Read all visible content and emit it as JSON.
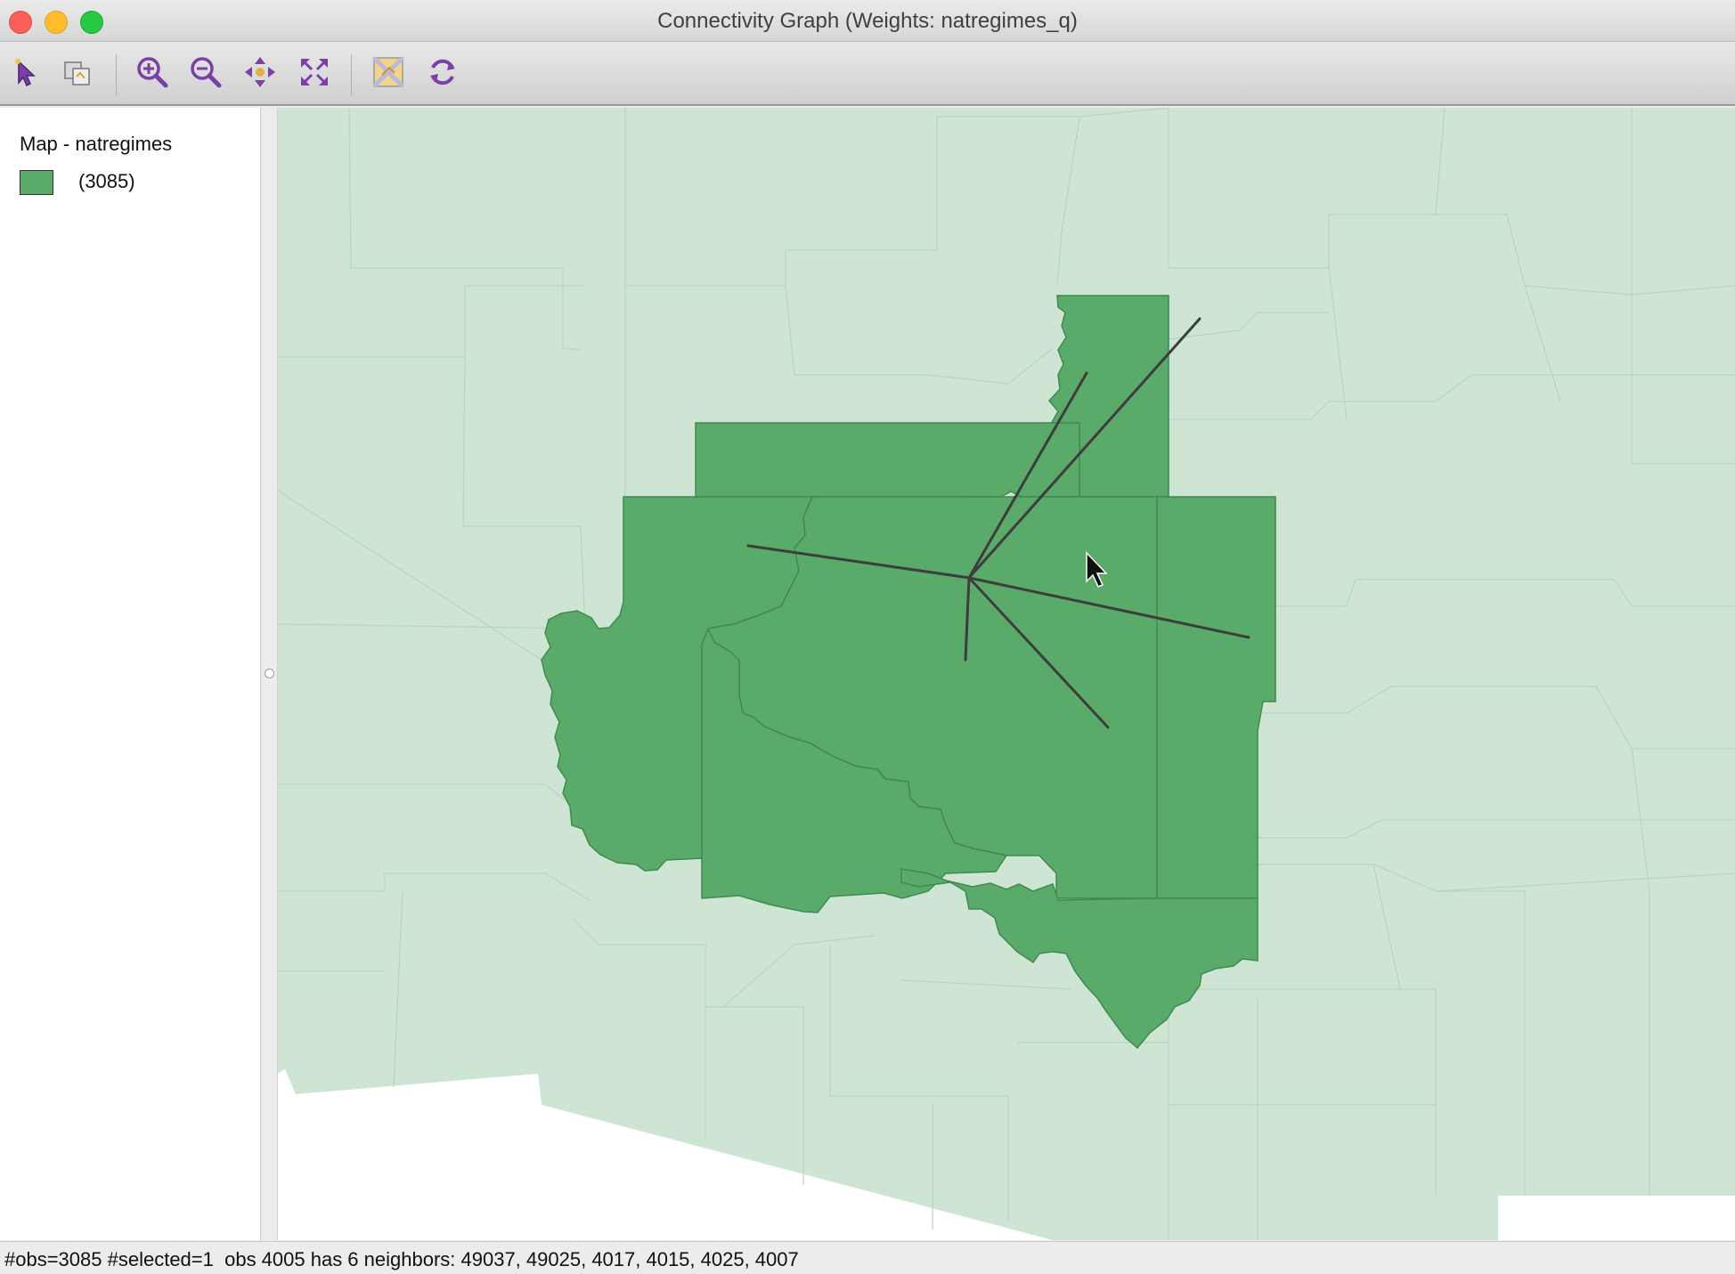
{
  "window": {
    "title": "Connectivity Graph (Weights: natregimes_q)"
  },
  "toolbar": {
    "buttons": [
      {
        "name": "select-tool-icon",
        "label": "Select"
      },
      {
        "name": "copy-selection-icon",
        "label": "Selection shape"
      },
      {
        "name": "zoom-in-icon",
        "label": "Zoom In"
      },
      {
        "name": "zoom-out-icon",
        "label": "Zoom Out"
      },
      {
        "name": "pan-icon",
        "label": "Pan"
      },
      {
        "name": "full-extent-icon",
        "label": "Full Extent"
      },
      {
        "name": "map-layers-icon",
        "label": "Basemap"
      },
      {
        "name": "refresh-icon",
        "label": "Refresh"
      }
    ]
  },
  "legend": {
    "title": "Map - natregimes",
    "items": [
      {
        "label": "(3085)",
        "color": "#5aaa6a"
      }
    ]
  },
  "map": {
    "background_color": "#cfe5d4",
    "selected_color": "#5aaa6a",
    "border_color": "#b9d3bf",
    "edge_color": "#3d3d3d"
  },
  "status": {
    "text": "#obs=3085 #selected=1  obs 4005 has 6 neighbors: 49037, 49025, 4017, 4015, 4025, 4007"
  }
}
